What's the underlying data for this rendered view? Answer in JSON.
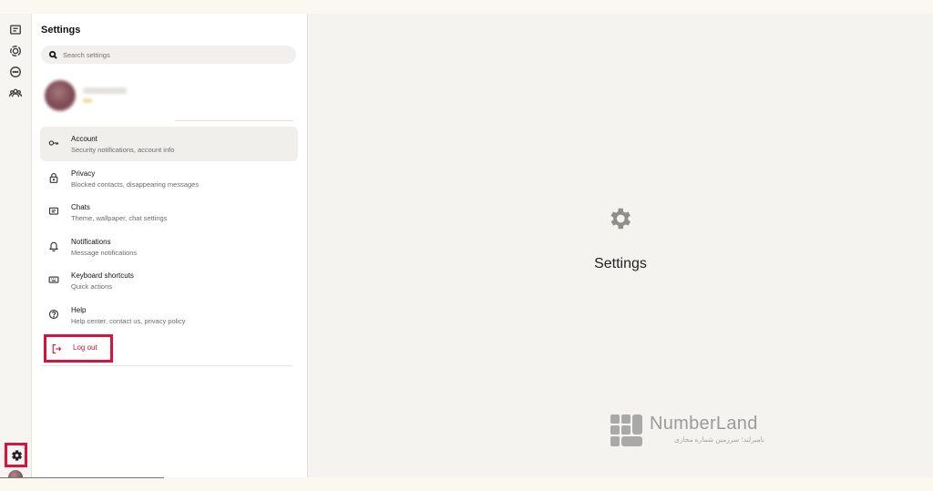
{
  "panel": {
    "title": "Settings",
    "search_placeholder": "Search settings"
  },
  "menu": [
    {
      "title": "Account",
      "subtitle": "Security notifications, account info",
      "icon": "key-icon"
    },
    {
      "title": "Privacy",
      "subtitle": "Blocked contacts, disappearing messages",
      "icon": "lock-icon"
    },
    {
      "title": "Chats",
      "subtitle": "Theme, wallpaper, chat settings",
      "icon": "chat-icon"
    },
    {
      "title": "Notifications",
      "subtitle": "Message notifications",
      "icon": "bell-icon"
    },
    {
      "title": "Keyboard shortcuts",
      "subtitle": "Quick actions",
      "icon": "keyboard-icon"
    },
    {
      "title": "Help",
      "subtitle": "Help center, contact us, privacy policy",
      "icon": "help-icon"
    }
  ],
  "logout": {
    "label": "Log out",
    "icon": "logout-icon",
    "color": "#d8123c"
  },
  "main": {
    "title": "Settings",
    "icon": "gear-icon"
  },
  "watermark": {
    "name": "NumberLand",
    "tagline": "نامبرلند؛ سرزمین شماره مجازی"
  },
  "rail_icons": [
    "chats-icon",
    "status-icon",
    "channels-icon",
    "communities-icon",
    "settings-icon",
    "profile-avatar"
  ],
  "colors": {
    "highlight": "#d8123c",
    "active_item_bg": "#f1efec"
  }
}
